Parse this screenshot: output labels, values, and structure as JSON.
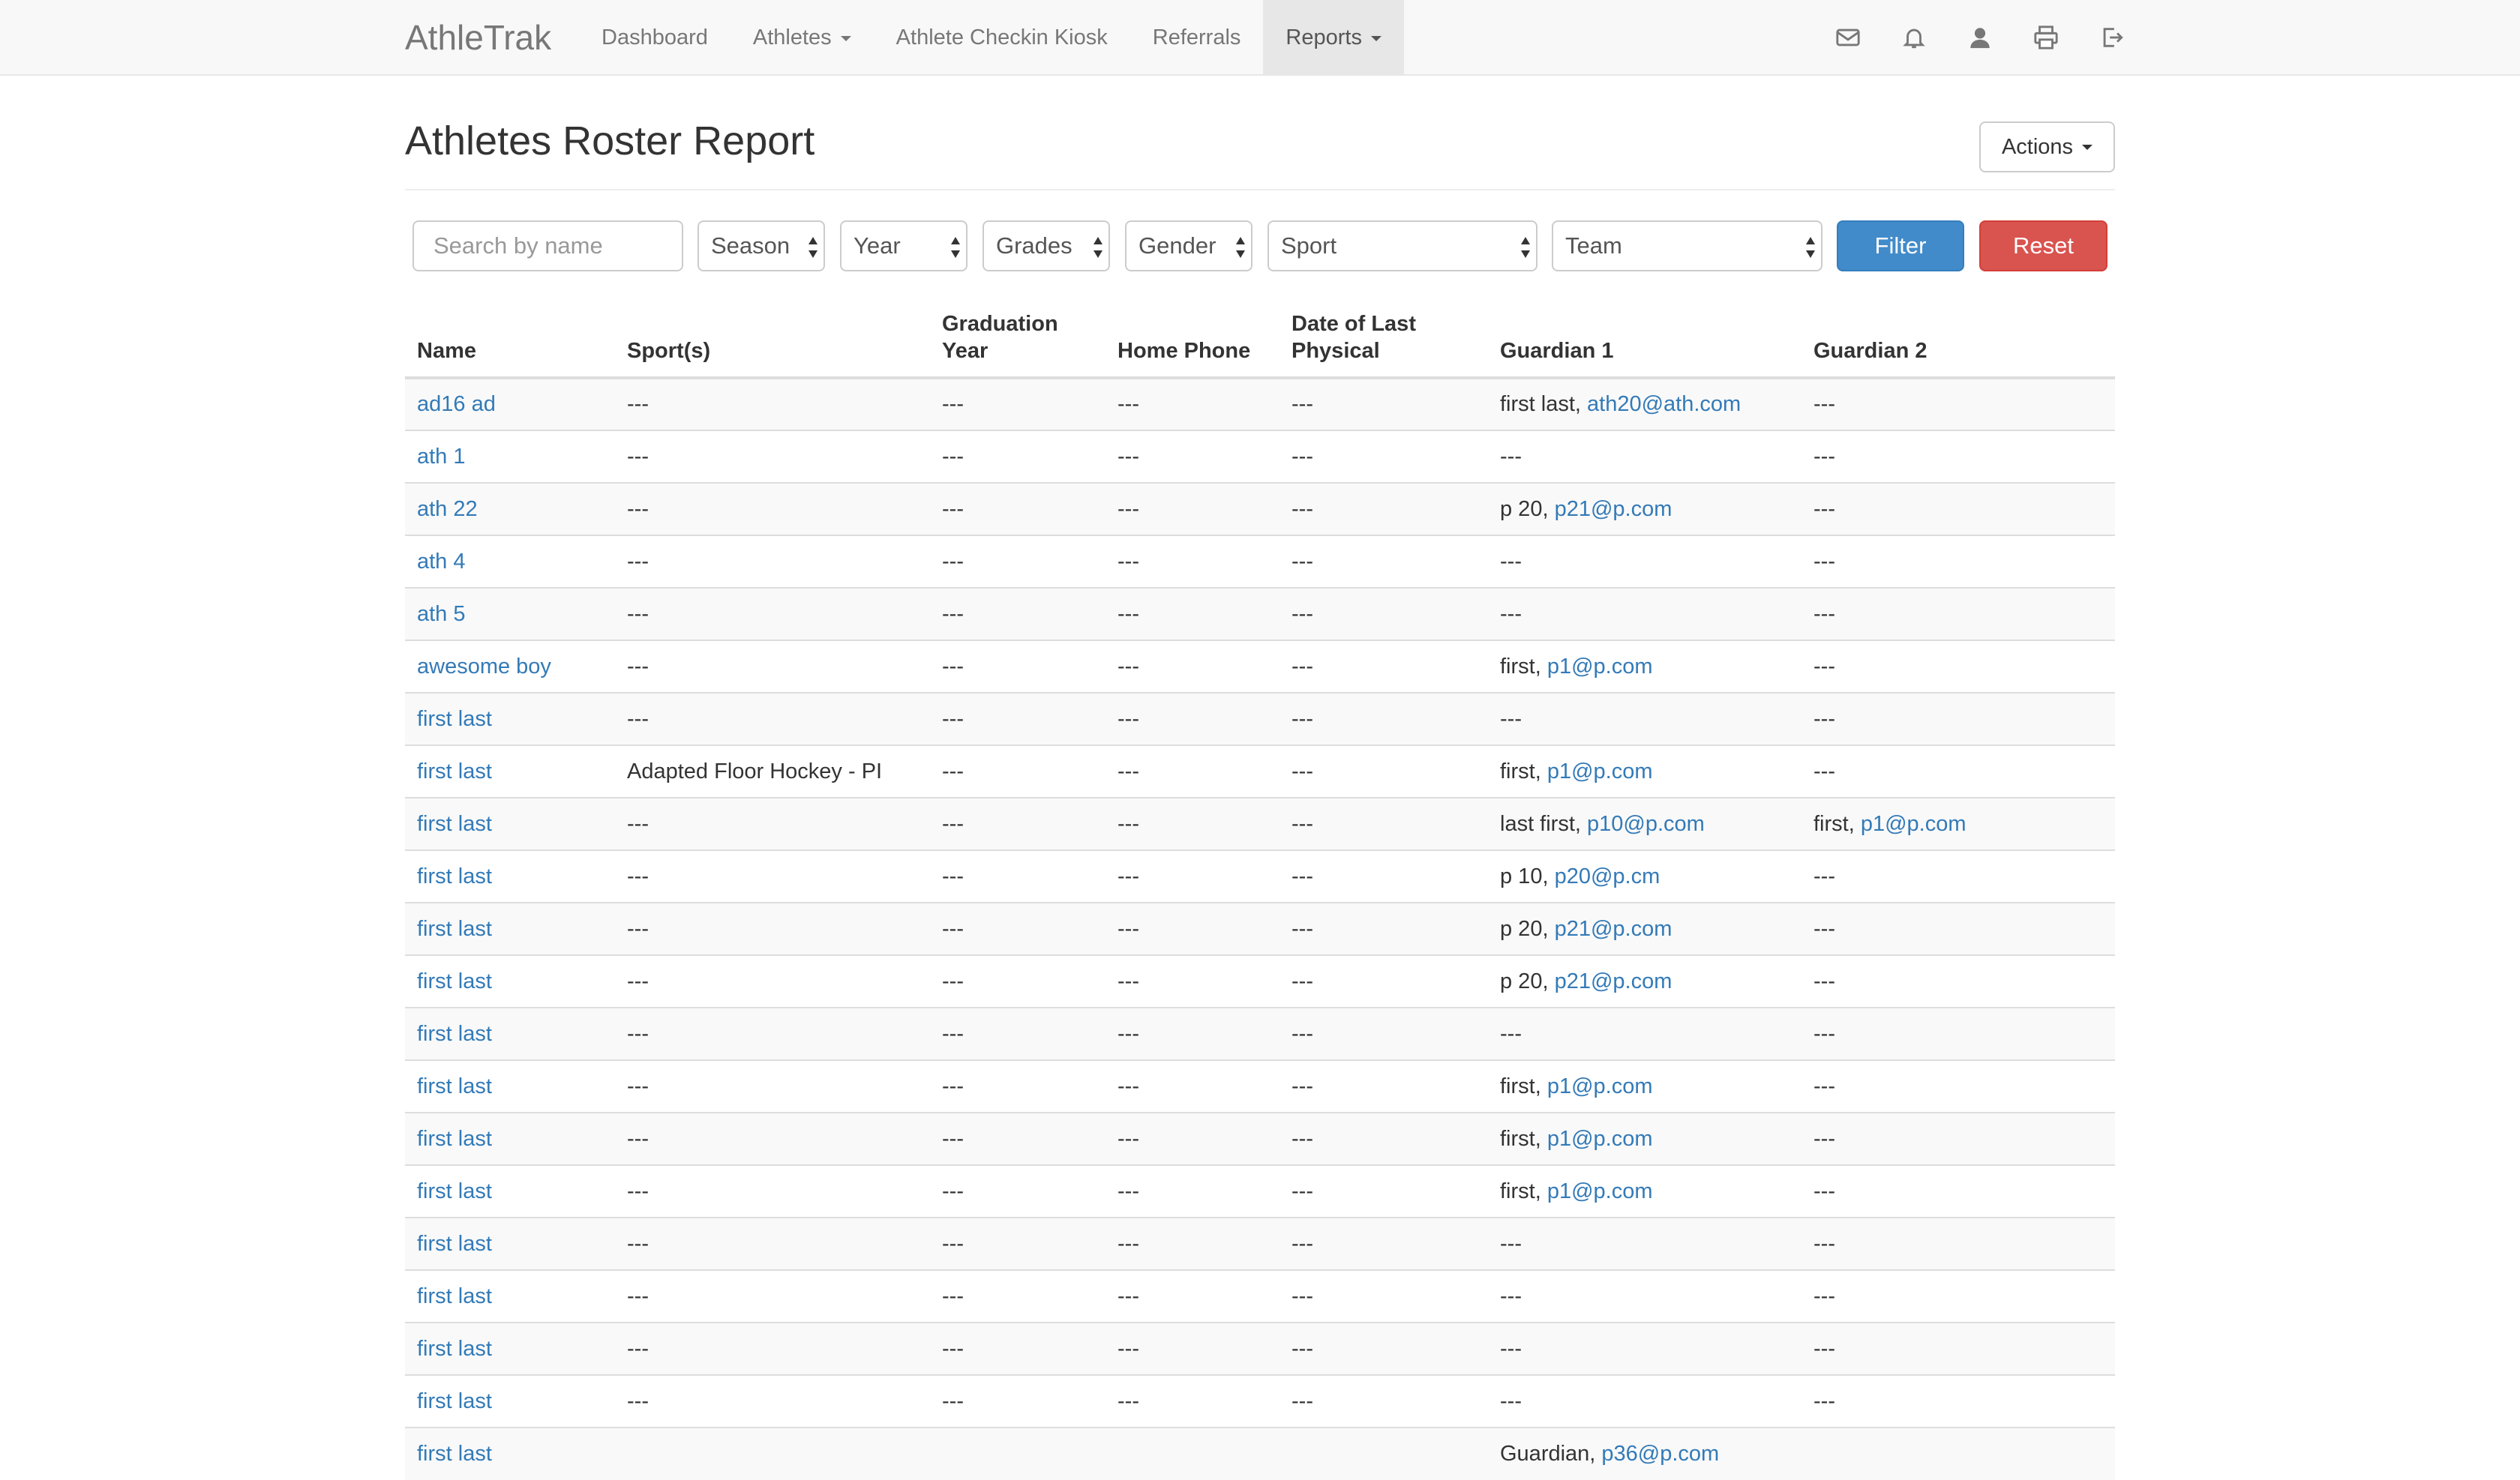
{
  "navbar": {
    "brand": "AthleTrak",
    "items": [
      {
        "label": "Dashboard"
      },
      {
        "label": "Athletes"
      },
      {
        "label": "Athlete Checkin Kiosk"
      },
      {
        "label": "Referrals"
      },
      {
        "label": "Reports"
      }
    ],
    "icons": [
      "envelope-icon",
      "bell-icon",
      "user-icon",
      "print-icon",
      "sign-out-icon"
    ]
  },
  "page": {
    "title": "Athletes Roster Report",
    "actions_label": "Actions"
  },
  "filters": {
    "search_placeholder": "Search by name",
    "season": "Season",
    "year": "Year",
    "grades": "Grades",
    "gender": "Gender",
    "sport": "Sport",
    "team": "Team",
    "filter_label": "Filter",
    "reset_label": "Reset"
  },
  "colors": {
    "primary": "#428bca",
    "danger": "#d9534f",
    "link": "#337ab7"
  },
  "table": {
    "columns": {
      "name": "Name",
      "sports": "Sport(s)",
      "grad_1": "Graduation",
      "grad_2": "Year",
      "phone": "Home Phone",
      "physical_1": "Date of Last",
      "physical_2": "Physical",
      "guardian1": "Guardian 1",
      "guardian2": "Guardian 2"
    },
    "rows": [
      {
        "name": "ad16 ad",
        "sports": "---",
        "grad": "---",
        "phone": "---",
        "physical": "---",
        "g1_text": "first last, ",
        "g1_email": "ath20@ath.com",
        "g2_text": "---",
        "g2_email": ""
      },
      {
        "name": "ath 1",
        "sports": "---",
        "grad": "---",
        "phone": "---",
        "physical": "---",
        "g1_text": "---",
        "g1_email": "",
        "g2_text": "---",
        "g2_email": ""
      },
      {
        "name": "ath 22",
        "sports": "---",
        "grad": "---",
        "phone": "---",
        "physical": "---",
        "g1_text": "p 20, ",
        "g1_email": "p21@p.com",
        "g2_text": "---",
        "g2_email": ""
      },
      {
        "name": "ath 4",
        "sports": "---",
        "grad": "---",
        "phone": "---",
        "physical": "---",
        "g1_text": "---",
        "g1_email": "",
        "g2_text": "---",
        "g2_email": ""
      },
      {
        "name": "ath 5",
        "sports": "---",
        "grad": "---",
        "phone": "---",
        "physical": "---",
        "g1_text": "---",
        "g1_email": "",
        "g2_text": "---",
        "g2_email": ""
      },
      {
        "name": "awesome boy",
        "sports": "---",
        "grad": "---",
        "phone": "---",
        "physical": "---",
        "g1_text": "first, ",
        "g1_email": "p1@p.com",
        "g2_text": "---",
        "g2_email": ""
      },
      {
        "name": "first last",
        "sports": "---",
        "grad": "---",
        "phone": "---",
        "physical": "---",
        "g1_text": "---",
        "g1_email": "",
        "g2_text": "---",
        "g2_email": ""
      },
      {
        "name": "first last",
        "sports": "Adapted Floor Hockey - PI",
        "grad": "---",
        "phone": "---",
        "physical": "---",
        "g1_text": "first, ",
        "g1_email": "p1@p.com",
        "g2_text": "---",
        "g2_email": ""
      },
      {
        "name": "first last",
        "sports": "---",
        "grad": "---",
        "phone": "---",
        "physical": "---",
        "g1_text": "last first, ",
        "g1_email": "p10@p.com",
        "g2_text": "first, ",
        "g2_email": "p1@p.com"
      },
      {
        "name": "first last",
        "sports": "---",
        "grad": "---",
        "phone": "---",
        "physical": "---",
        "g1_text": "p 10, ",
        "g1_email": "p20@p.cm",
        "g2_text": "---",
        "g2_email": ""
      },
      {
        "name": "first last",
        "sports": "---",
        "grad": "---",
        "phone": "---",
        "physical": "---",
        "g1_text": "p 20, ",
        "g1_email": "p21@p.com",
        "g2_text": "---",
        "g2_email": ""
      },
      {
        "name": "first last",
        "sports": "---",
        "grad": "---",
        "phone": "---",
        "physical": "---",
        "g1_text": "p 20, ",
        "g1_email": "p21@p.com",
        "g2_text": "---",
        "g2_email": ""
      },
      {
        "name": "first last",
        "sports": "---",
        "grad": "---",
        "phone": "---",
        "physical": "---",
        "g1_text": "---",
        "g1_email": "",
        "g2_text": "---",
        "g2_email": ""
      },
      {
        "name": "first last",
        "sports": "---",
        "grad": "---",
        "phone": "---",
        "physical": "---",
        "g1_text": "first, ",
        "g1_email": "p1@p.com",
        "g2_text": "---",
        "g2_email": ""
      },
      {
        "name": "first last",
        "sports": "---",
        "grad": "---",
        "phone": "---",
        "physical": "---",
        "g1_text": "first, ",
        "g1_email": "p1@p.com",
        "g2_text": "---",
        "g2_email": ""
      },
      {
        "name": "first last",
        "sports": "---",
        "grad": "---",
        "phone": "---",
        "physical": "---",
        "g1_text": "first, ",
        "g1_email": "p1@p.com",
        "g2_text": "---",
        "g2_email": ""
      },
      {
        "name": "first last",
        "sports": "---",
        "grad": "---",
        "phone": "---",
        "physical": "---",
        "g1_text": "---",
        "g1_email": "",
        "g2_text": "---",
        "g2_email": ""
      },
      {
        "name": "first last",
        "sports": "---",
        "grad": "---",
        "phone": "---",
        "physical": "---",
        "g1_text": "---",
        "g1_email": "",
        "g2_text": "---",
        "g2_email": ""
      },
      {
        "name": "first last",
        "sports": "---",
        "grad": "---",
        "phone": "---",
        "physical": "---",
        "g1_text": "---",
        "g1_email": "",
        "g2_text": "---",
        "g2_email": ""
      },
      {
        "name": "first last",
        "sports": "---",
        "grad": "---",
        "phone": "---",
        "physical": "---",
        "g1_text": "---",
        "g1_email": "",
        "g2_text": "---",
        "g2_email": ""
      },
      {
        "name": "first last",
        "sports": "",
        "grad": "",
        "phone": "",
        "physical": "",
        "g1_text": "Guardian, ",
        "g1_email": "p36@p.com",
        "g2_text": "",
        "g2_email": ""
      }
    ]
  }
}
